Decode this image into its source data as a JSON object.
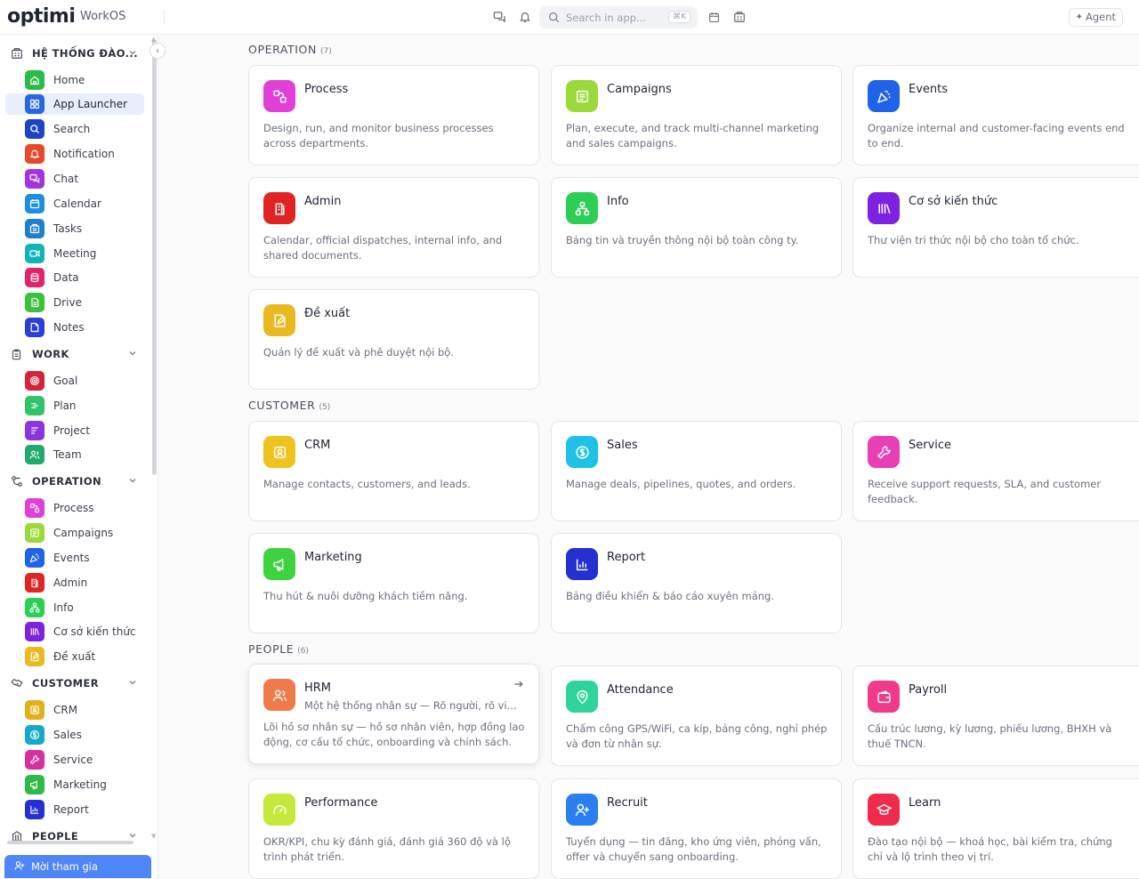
{
  "header": {
    "logo": "optimi",
    "product": "WorkOS",
    "search_placeholder": "Search in app...",
    "search_kbd": "⌘K",
    "agent_label": "Agent"
  },
  "sidebar": {
    "join_label": "Mời tham gia",
    "groups": [
      {
        "title": "HỆ THỐNG ĐÀO...",
        "items": [
          "Home",
          "App Launcher",
          "Search",
          "Notification",
          "Chat",
          "Calendar",
          "Tasks",
          "Meeting",
          "Data",
          "Drive",
          "Notes"
        ]
      },
      {
        "title": "WORK",
        "items": [
          "Goal",
          "Plan",
          "Project",
          "Team"
        ]
      },
      {
        "title": "OPERATION",
        "items": [
          "Process",
          "Campaigns",
          "Events",
          "Admin",
          "Info",
          "Cơ sở kiến thức",
          "Đề xuất"
        ]
      },
      {
        "title": "CUSTOMER",
        "items": [
          "CRM",
          "Sales",
          "Service",
          "Marketing",
          "Report"
        ]
      },
      {
        "title": "PEOPLE",
        "items": []
      }
    ]
  },
  "sections": [
    {
      "title": "OPERATION",
      "count": "(7)",
      "cards": [
        {
          "title": "Process",
          "desc": "Design, run, and monitor business processes across departments.",
          "icon": "process-icon",
          "color": "#e23fd9"
        },
        {
          "title": "Campaigns",
          "desc": "Plan, execute, and track multi-channel marketing and sales campaigns.",
          "icon": "campaigns-icon",
          "color": "#9ad93a"
        },
        {
          "title": "Events",
          "desc": "Organize internal and customer-facing events end to end.",
          "icon": "events-icon",
          "color": "#1f63e8"
        },
        {
          "title": "Admin",
          "desc": "Calendar, official dispatches, internal info, and shared documents.",
          "icon": "admin-icon",
          "color": "#e02424"
        },
        {
          "title": "Info",
          "desc": "Bảng tin và truyền thông nội bộ toàn công ty.",
          "icon": "info-icon",
          "color": "#2ccf55"
        },
        {
          "title": "Cơ sở kiến thức",
          "desc": "Thư viện tri thức nội bộ cho toàn tổ chức.",
          "icon": "knowledge-icon",
          "color": "#7c22e0"
        },
        {
          "title": "Đề xuất",
          "desc": "Quản lý đề xuất và phê duyệt nội bộ.",
          "icon": "proposal-icon",
          "color": "#eab91f"
        }
      ]
    },
    {
      "title": "CUSTOMER",
      "count": "(5)",
      "cards": [
        {
          "title": "CRM",
          "desc": "Manage contacts, customers, and leads.",
          "icon": "crm-icon",
          "color": "#f0c21f"
        },
        {
          "title": "Sales",
          "desc": "Manage deals, pipelines, quotes, and orders.",
          "icon": "sales-icon",
          "color": "#1fc2e6"
        },
        {
          "title": "Service",
          "desc": "Receive support requests, SLA, and customer feedback.",
          "icon": "service-icon",
          "color": "#e83fb4"
        },
        {
          "title": "Marketing",
          "desc": "Thu hút & nuôi dưỡng khách tiềm năng.",
          "icon": "marketing-icon",
          "color": "#3ed33e"
        },
        {
          "title": "Report",
          "desc": "Bảng điều khiển & báo cáo xuyên mảng.",
          "icon": "report-icon",
          "color": "#2430cf"
        }
      ]
    },
    {
      "title": "PEOPLE",
      "count": "(6)",
      "cards": [
        {
          "title": "HRM",
          "subtitle": "Một hệ thống nhân sự — Rõ người, rõ vi...",
          "desc": "Lõi hồ sơ nhân sự — hồ sơ nhân viên, hợp đồng lao động, cơ cấu tổ chức, onboarding và chính sách.",
          "icon": "hrm-icon",
          "color": "#f07a4a"
        },
        {
          "title": "Attendance",
          "desc": "Chấm công GPS/WiFi, ca kíp, bảng công, nghỉ phép và đơn từ nhân sự.",
          "icon": "attendance-icon",
          "color": "#2ed49a"
        },
        {
          "title": "Payroll",
          "desc": "Cấu trúc lương, kỳ lương, phiếu lương, BHXH và thuế TNCN.",
          "icon": "payroll-icon",
          "color": "#f03a8c"
        },
        {
          "title": "Performance",
          "desc": "OKR/KPI, chu kỳ đánh giá, đánh giá 360 độ và lộ trình phát triển.",
          "icon": "performance-icon",
          "color": "#c6e83a"
        },
        {
          "title": "Recruit",
          "desc": "Tuyển dụng — tin đăng, kho ứng viên, phỏng vấn, offer và chuyển sang onboarding.",
          "icon": "recruit-icon",
          "color": "#2a7ef0"
        },
        {
          "title": "Learn",
          "desc": "Đào tạo nội bộ — khoá học, bài kiểm tra, chứng chỉ và lộ trình theo vị trí.",
          "icon": "learn-icon",
          "color": "#f02a4a"
        }
      ]
    }
  ],
  "colors": {
    "accent": "#4f86f7",
    "nav_active_bg": "#e8eefb"
  }
}
